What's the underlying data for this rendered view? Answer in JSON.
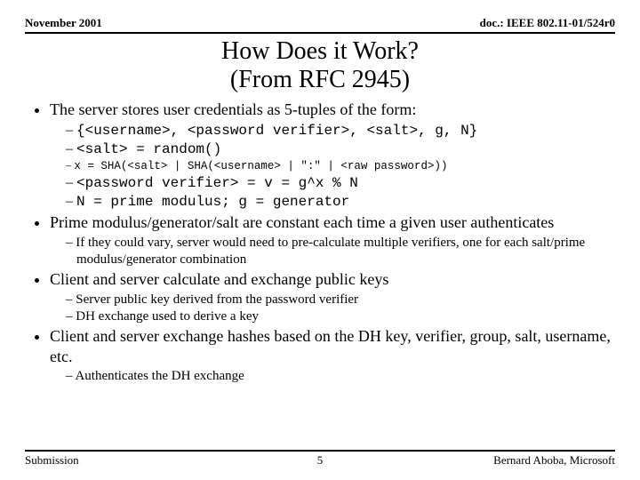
{
  "header": {
    "left": "November 2001",
    "right": "doc.: IEEE 802.11-01/524r0"
  },
  "title": {
    "line1": "How Does it Work?",
    "line2": "(From RFC 2945)"
  },
  "bullets": {
    "b1": "The server stores user credentials as 5-tuples of the form:",
    "b1_sub": {
      "s1": "{<username>, <password verifier>, <salt>, g, N}",
      "s2": "<salt> = random()",
      "s3": "x = SHA(<salt> | SHA(<username> | \":\" | <raw password>))",
      "s4": "<password verifier> = v = g^x % N",
      "s5": "N = prime modulus; g = generator"
    },
    "b2": "Prime modulus/generator/salt are constant each time a given user authenticates",
    "b2_sub": {
      "s1": "If they could vary, server would need to pre-calculate multiple verifiers, one for each salt/prime modulus/generator combination"
    },
    "b3": "Client and server calculate and exchange public keys",
    "b3_sub": {
      "s1": "Server public key derived from the password verifier",
      "s2": "DH exchange used to derive a key"
    },
    "b4": "Client and server exchange hashes based on the DH key, verifier, group, salt, username, etc.",
    "b4_sub": {
      "s1": "Authenticates the DH exchange"
    }
  },
  "footer": {
    "left": "Submission",
    "center": "5",
    "right": "Bernard Aboba, Microsoft"
  }
}
